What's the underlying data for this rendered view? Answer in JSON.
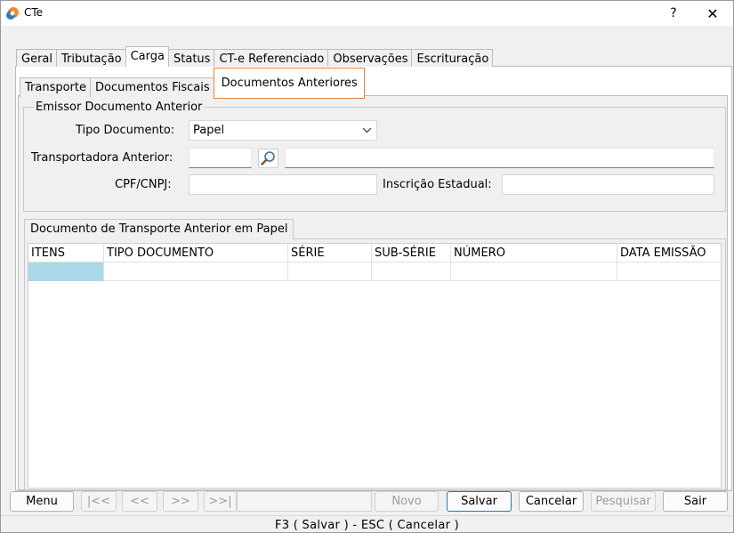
{
  "window": {
    "title": "CTe",
    "help_label": "?",
    "close_label": "✕"
  },
  "tabs_main": [
    "Geral",
    "Tributação",
    "Carga",
    "Status",
    "CT-e Referenciado",
    "Observações",
    "Escrituração"
  ],
  "tabs_sub": [
    "Transporte",
    "Documentos Fiscais",
    "Documentos Anteriores"
  ],
  "emissor": {
    "legend": "Emissor Documento Anterior",
    "tipo_documento_label": "Tipo Documento:",
    "tipo_documento_value": "Papel",
    "transportadora_label": "Transportadora Anterior:",
    "transportadora_code": "",
    "transportadora_name": "",
    "cpf_label": "CPF/CNPJ:",
    "cpf_value": "",
    "ie_label": "Inscrição Estadual:",
    "ie_value": ""
  },
  "grid": {
    "tab_label": "Documento de Transporte Anterior em Papel",
    "columns": [
      "ITENS",
      "TIPO DOCUMENTO",
      "SÉRIE",
      "SUB-SÉRIE",
      "NÚMERO",
      "DATA EMISSÃO"
    ],
    "rows": [
      [
        "",
        "",
        "",
        "",
        "",
        ""
      ]
    ]
  },
  "buttons": {
    "menu": "Menu",
    "first": "|<<",
    "prev": "<<",
    "next": ">>",
    "last": ">>|",
    "novo": "Novo",
    "salvar": "Salvar",
    "cancelar": "Cancelar",
    "pesquisar": "Pesquisar",
    "sair": "Sair"
  },
  "status_text": "F3 ( Salvar )  -  ESC ( Cancelar )",
  "colors": {
    "accent_tab": "#e8823a",
    "selected_cell": "#aad8e6",
    "primary_border": "#2a7ca8"
  }
}
